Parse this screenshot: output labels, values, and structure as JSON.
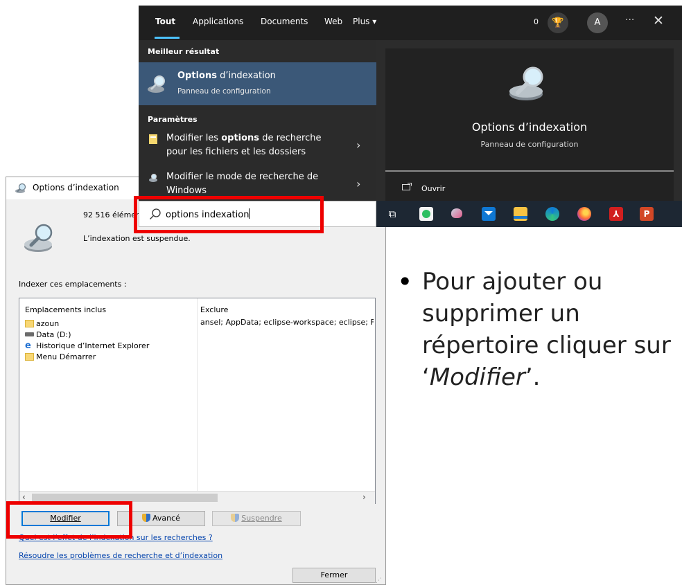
{
  "dialog": {
    "title": "Options d’indexation",
    "item_count": "92 516 élémen",
    "status": "L’indexation est suspendue.",
    "locations_label": "Indexer ces emplacements :",
    "columns": {
      "included": "Emplacements inclus",
      "exclude": "Exclure"
    },
    "locations": [
      {
        "name": "azoun",
        "icon": "folder-icon"
      },
      {
        "name": "Data (D:)",
        "icon": "drive-icon"
      },
      {
        "name": "Historique d’Internet Explorer",
        "icon": "ie-icon"
      },
      {
        "name": "Menu Démarrer",
        "icon": "folder-icon"
      }
    ],
    "exclude_text": "ansel; AppData; eclipse-workspace; eclipse; Fc",
    "buttons": {
      "modify": "Modifier",
      "advanced": "Avancé",
      "suspend": "Suspendre",
      "close": "Fermer"
    },
    "links": {
      "effect": "Quel est l’effet de l’indexation sur les recherches ?",
      "troubleshoot": "Résoudre les problèmes de recherche et d’indexation"
    }
  },
  "search": {
    "tabs": [
      "Tout",
      "Applications",
      "Documents",
      "Web",
      "Plus ▾"
    ],
    "active_tab": "Tout",
    "points": "0",
    "avatar_letter": "A",
    "best_match_header": "Meilleur résultat",
    "best_match": {
      "title_bold": "Options",
      "title_rest": " d’indexation",
      "subtitle": "Panneau de configuration"
    },
    "settings_header": "Paramètres",
    "settings": [
      {
        "line1_pre": "Modifier les ",
        "line1_bold": "options",
        "line1_post": " de recherche",
        "line2": "pour les fichiers et les dossiers"
      },
      {
        "line1_pre": "Modifier le mode de recherche de",
        "line1_bold": "",
        "line1_post": "",
        "line2": "Windows"
      }
    ],
    "preview": {
      "title": "Options d’indexation",
      "subtitle": "Panneau de configuration",
      "action": "Ouvrir"
    },
    "query": "options indexation"
  },
  "taskbar": {
    "icons": [
      "task-view-icon",
      "evernote-icon",
      "paint-icon",
      "mail-icon",
      "file-explorer-icon",
      "edge-icon",
      "firefox-icon",
      "acrobat-icon",
      "powerpoint-icon"
    ]
  },
  "bullet": {
    "line1": "Pour ajouter ou",
    "line2": "supprimer un",
    "line3": "répertoire cliquer sur",
    "line4_open": "‘",
    "line4_em": "Modifier",
    "line4_close": "’."
  },
  "colors": {
    "highlight_red": "#ee0000",
    "search_selected": "#3b5878",
    "accent": "#4cc2ff"
  }
}
